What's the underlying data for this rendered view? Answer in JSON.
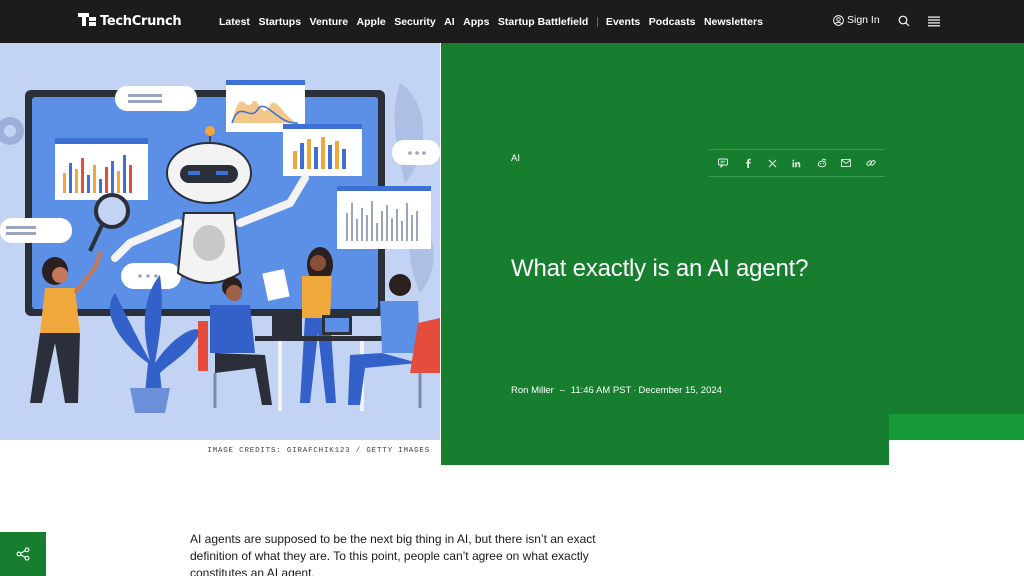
{
  "nav": {
    "logo_text": "TechCrunch",
    "items": [
      "Latest",
      "Startups",
      "Venture",
      "Apple",
      "Security",
      "AI",
      "Apps",
      "Startup Battlefield",
      "Events",
      "Podcasts",
      "Newsletters"
    ],
    "signin_label": "Sign In",
    "icons": [
      "user-icon",
      "search-icon",
      "menu-icon"
    ]
  },
  "hero": {
    "image_credits": "IMAGE CREDITS: GIRAFCHIK123 / GETTY IMAGES",
    "category": "AI",
    "title": "What exactly is an AI agent?",
    "author": "Ron Miller",
    "time": "11:46 AM PST",
    "date_sep": "·",
    "date": "December 15, 2024",
    "share_icons": [
      "comment-icon",
      "facebook-icon",
      "x-icon",
      "linkedin-icon",
      "reddit-icon",
      "email-icon",
      "link-icon"
    ]
  },
  "article": {
    "line1": "AI agents are supposed to be the next big thing in AI, but there isn’t an exact",
    "line2": "definition of what they are. To this point, people can’t agree on what exactly",
    "line3": "constitutes an AI agent."
  },
  "colors": {
    "nav_bg": "#1c1c1c",
    "green": "#177e2f",
    "green_light": "#169a37",
    "illustration_bg": "#c3d3f4"
  }
}
